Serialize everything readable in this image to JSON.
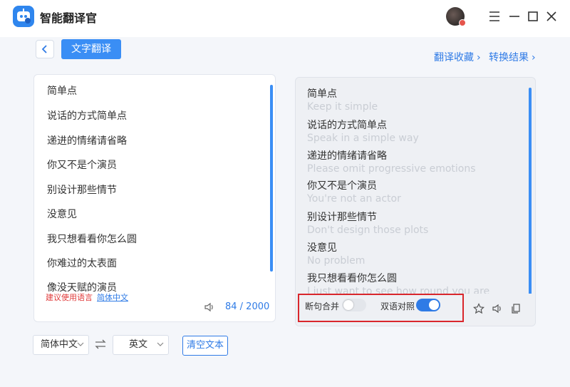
{
  "app": {
    "title": "智能翻译官",
    "icons": {
      "logo": "robot-logo-icon",
      "avatar": "user-avatar"
    }
  },
  "window_controls": [
    "shirt-skin-icon",
    "minimize-icon",
    "maximize-icon",
    "close-icon"
  ],
  "toolbar": {
    "back_icon": "chevron-left-icon",
    "mode_tab": "文字翻译",
    "links": [
      {
        "label": "翻译收藏",
        "chevron": "›"
      },
      {
        "label": "转换结果",
        "chevron": "›"
      }
    ]
  },
  "source": {
    "lines": [
      "简单点",
      "说话的方式简单点",
      "递进的情绪请省略",
      "你又不是个演员",
      "别设计那些情节",
      "没意见",
      "我只想看看你怎么圆",
      "你难过的太表面",
      "像没天赋的演员"
    ],
    "suggest_label": "建议使用语言",
    "suggest_lang": "简体中文",
    "char_count": "84 / 2000"
  },
  "result": {
    "pairs": [
      {
        "zh": "简单点",
        "en": "Keep it simple"
      },
      {
        "zh": "说话的方式简单点",
        "en": "Speak in a simple way"
      },
      {
        "zh": "递进的情绪请省略",
        "en": "Please omit progressive emotions"
      },
      {
        "zh": "你又不是个演员",
        "en": "You're not an actor"
      },
      {
        "zh": "别设计那些情节",
        "en": "Don't design those plots"
      },
      {
        "zh": "没意见",
        "en": "No problem"
      },
      {
        "zh": "我只想看看你怎么圆",
        "en": "I just want to see how round you are"
      }
    ],
    "toggle_merge": {
      "label": "断句合并",
      "on": false
    },
    "toggle_bilingual": {
      "label": "双语对照",
      "on": true
    },
    "colors": {
      "accent": "#2f7be6",
      "highlight": "#d9262c"
    }
  },
  "lang_bar": {
    "source_lang": "简体中文",
    "target_lang": "英文",
    "clear_label": "清空文本"
  }
}
